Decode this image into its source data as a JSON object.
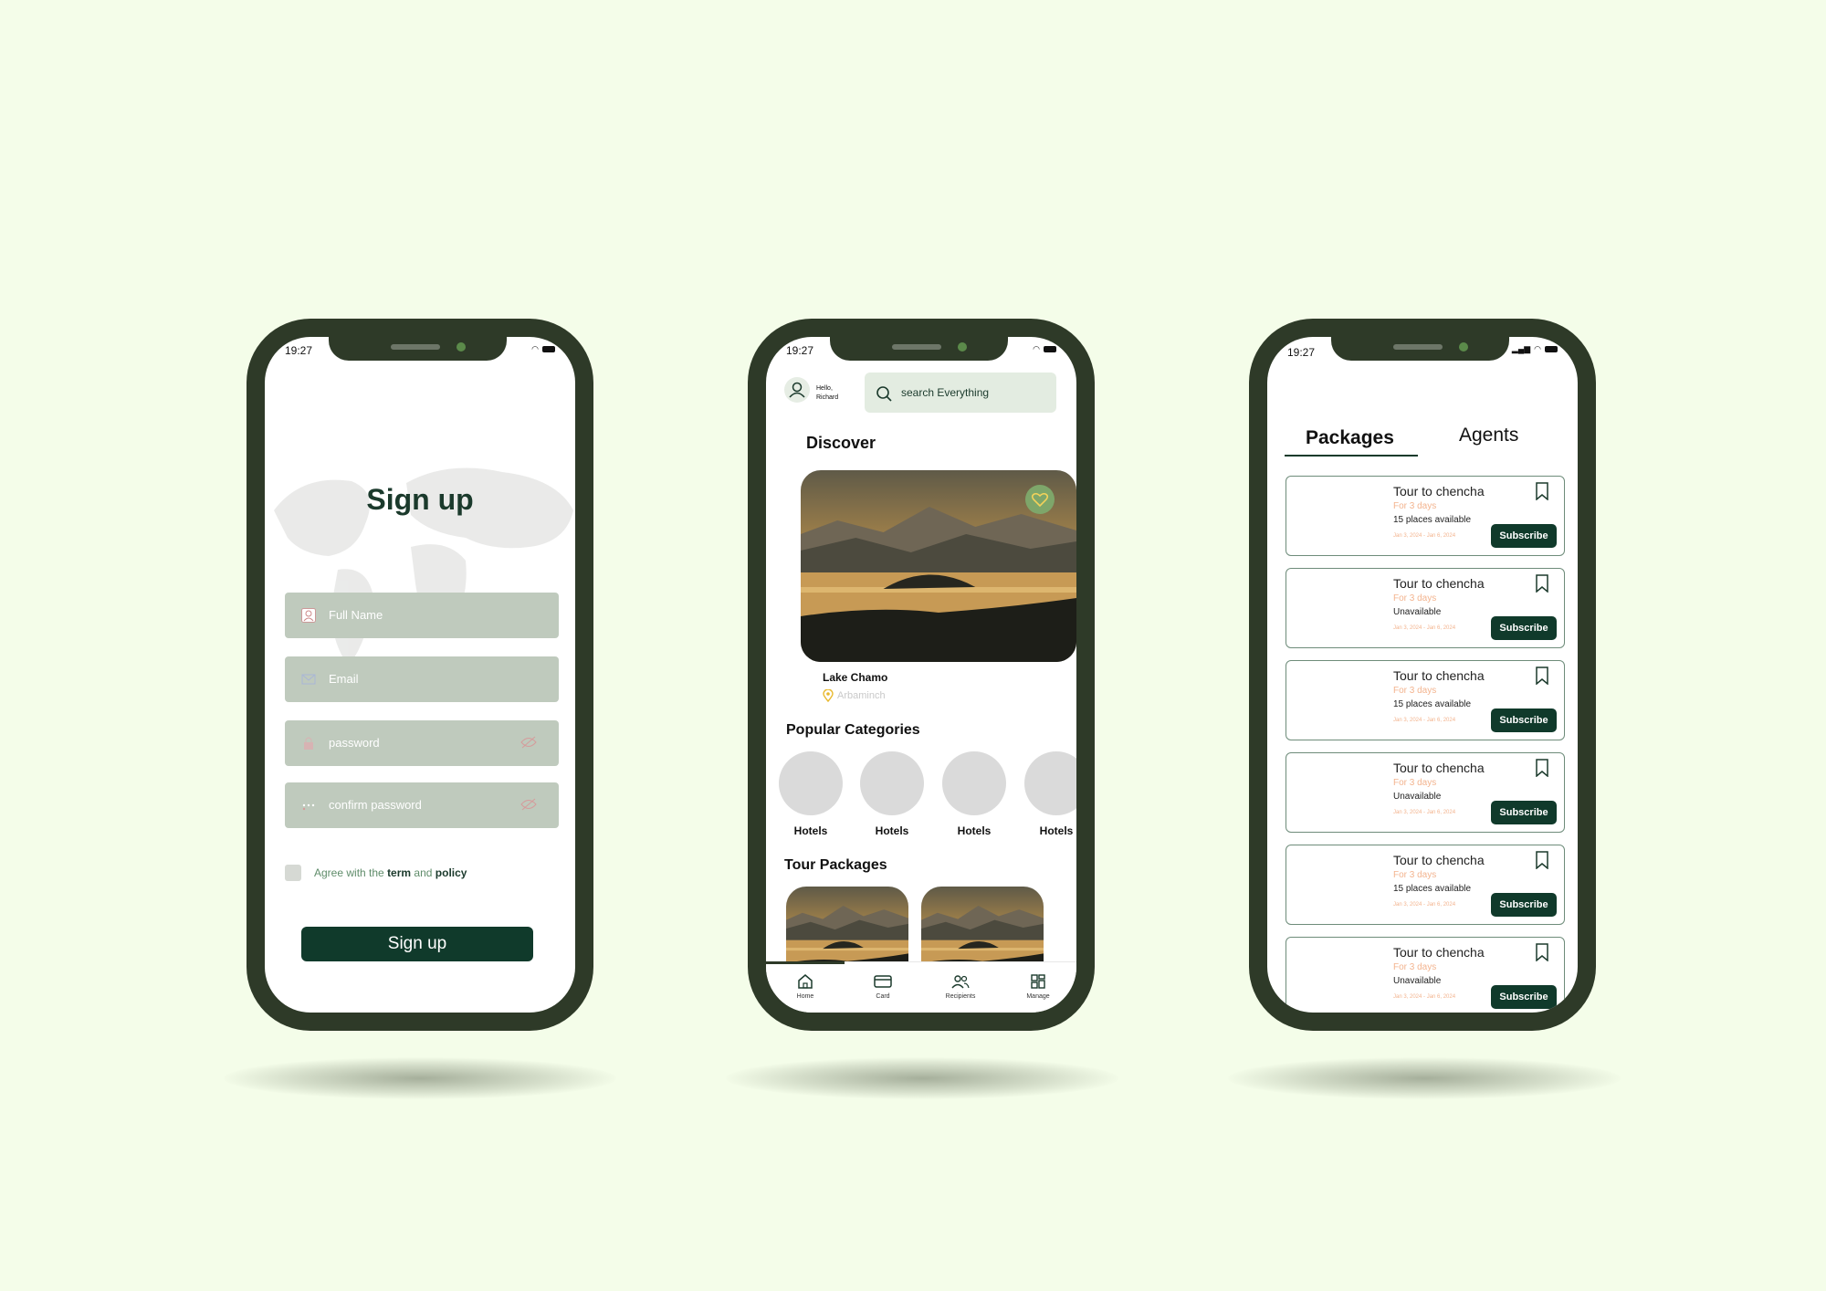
{
  "status_bar": {
    "time": "19:27"
  },
  "signup": {
    "title": "Sign up",
    "fields": [
      {
        "placeholder": "Full Name",
        "icon": "person-icon"
      },
      {
        "placeholder": "Email",
        "icon": "mail-icon"
      },
      {
        "placeholder": "password",
        "icon": "lock-icon"
      },
      {
        "placeholder": "confirm password",
        "icon": "dots-icon"
      }
    ],
    "agree": {
      "prefix": "Agree with the",
      "term": "term",
      "and": "and",
      "policy": "policy"
    },
    "button": "Sign up"
  },
  "home": {
    "greeting": "Hello,",
    "user": "Richard",
    "search_placeholder": "search Everything",
    "discover_heading": "Discover",
    "featured": {
      "title": "Lake Chamo",
      "location": "Arbaminch"
    },
    "categories_heading": "Popular Categories",
    "categories": [
      "Hotels",
      "Hotels",
      "Hotels",
      "Hotels"
    ],
    "tour_heading": "Tour Packages",
    "tabs": [
      {
        "label": "Home",
        "icon": "home-icon"
      },
      {
        "label": "Card",
        "icon": "card-icon"
      },
      {
        "label": "Recipients",
        "icon": "people-icon"
      },
      {
        "label": "Manage",
        "icon": "grid-icon"
      }
    ]
  },
  "packages": {
    "tabs": [
      "Packages",
      "Agents"
    ],
    "items": [
      {
        "title": "Tour to chencha",
        "duration": "For 3 days",
        "status": "15 places available",
        "dates": "Jan 3, 2024 - Jan 6, 2024",
        "button": "Subscribe"
      },
      {
        "title": "Tour to chencha",
        "duration": "For 3 days",
        "status": "Unavailable",
        "dates": "Jan 3, 2024 - Jan 6, 2024",
        "button": "Subscribe"
      },
      {
        "title": "Tour to chencha",
        "duration": "For 3 days",
        "status": "15 places available",
        "dates": "Jan 3, 2024 - Jan 6, 2024",
        "button": "Subscribe"
      },
      {
        "title": "Tour to chencha",
        "duration": "For 3 days",
        "status": "Unavailable",
        "dates": "Jan 3, 2024 - Jan 6, 2024",
        "button": "Subscribe"
      },
      {
        "title": "Tour to chencha",
        "duration": "For 3 days",
        "status": "15 places available",
        "dates": "Jan 3, 2024 - Jan 6, 2024",
        "button": "Subscribe"
      },
      {
        "title": "Tour to chencha",
        "duration": "For 3 days",
        "status": "Unavailable",
        "dates": "Jan 3, 2024 - Jan 6, 2024",
        "button": "Subscribe"
      }
    ]
  },
  "colors": {
    "background": "#f4fde9",
    "phone_frame": "#2e3a28",
    "brand_dark": "#103a2b",
    "field": "#bfcabd",
    "accent_orange": "#f3b48f",
    "accent_green": "#7ea66a"
  }
}
